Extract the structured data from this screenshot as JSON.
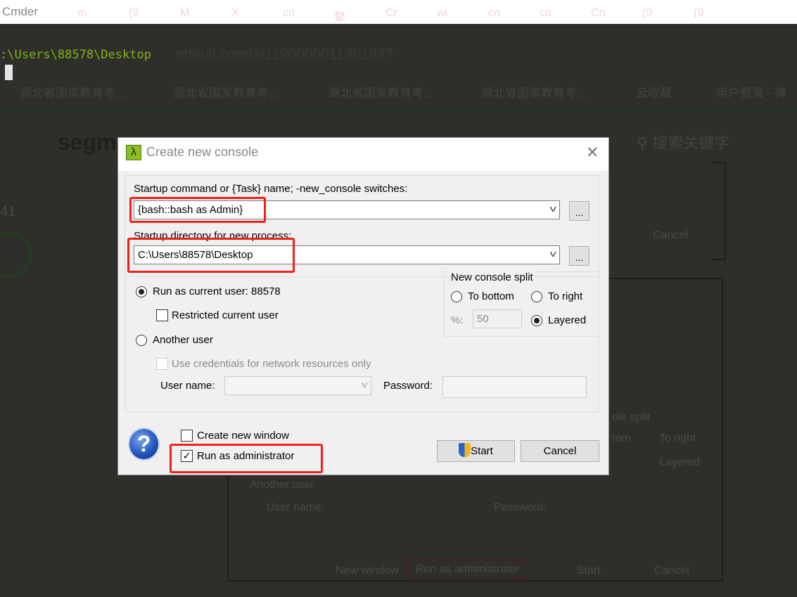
{
  "background": {
    "app_title": "Cmder",
    "browser_tabs": [
      "m",
      "(9",
      "M",
      "X",
      "cn",
      "婺",
      "Cr",
      "wi",
      "cn",
      "cn",
      "Cn",
      "(9",
      "(9"
    ],
    "prompt_path": ":\\Users\\88578\\Desktop",
    "url": "ntfault.com/a/1190000011361877",
    "bookmarks": [
      "湖北省国家教育考...",
      "湖北省国家教育考...",
      "湖北省国家教育考...",
      "湖北省国家教育考...",
      "云收藏",
      "用户登录 - 禅"
    ],
    "site_logo": "segm",
    "search_placeholder": "搜索关键字",
    "vote_count": "41",
    "ghost_dialog": {
      "cancel_top": "Cancel",
      "split_fragment": "ole split",
      "to_bottom_fragment": "tom",
      "to_right": "To right",
      "layered": "Layered",
      "another_user": "Another user",
      "user_name": "User name:",
      "password": "Password:",
      "new_window": "New window",
      "run_as_admin": "Run as administrator",
      "start": "Start",
      "cancel": "Cancel"
    }
  },
  "dialog": {
    "title": "Create new console",
    "command_label": "Startup command or {Task} name; -new_console switches:",
    "command_value": "{bash::bash as Admin}",
    "directory_label": "Startup directory for new process:",
    "directory_value": "C:\\Users\\88578\\Desktop",
    "browse_label": "...",
    "run_as_current_user": "Run as current user: 88578",
    "restricted_current_user": "Restricted current user",
    "another_user": "Another user",
    "use_credentials": "Use credentials for network resources only",
    "user_name_label": "User name:",
    "user_name_value": "",
    "password_label": "Password:",
    "password_value": "",
    "split": {
      "legend": "New console split",
      "to_bottom": "To bottom",
      "to_right": "To right",
      "percent_label": "%:",
      "percent_value": "50",
      "layered": "Layered",
      "selected": "Layered"
    },
    "selected_user_mode": "Run as current user",
    "create_new_window": "Create new window",
    "create_new_window_checked": false,
    "run_as_administrator": "Run as administrator",
    "run_as_administrator_checked": true,
    "start_button": "Start",
    "cancel_button": "Cancel",
    "highlight_color": "#f0201a",
    "accent_color": "#8cbf26"
  }
}
